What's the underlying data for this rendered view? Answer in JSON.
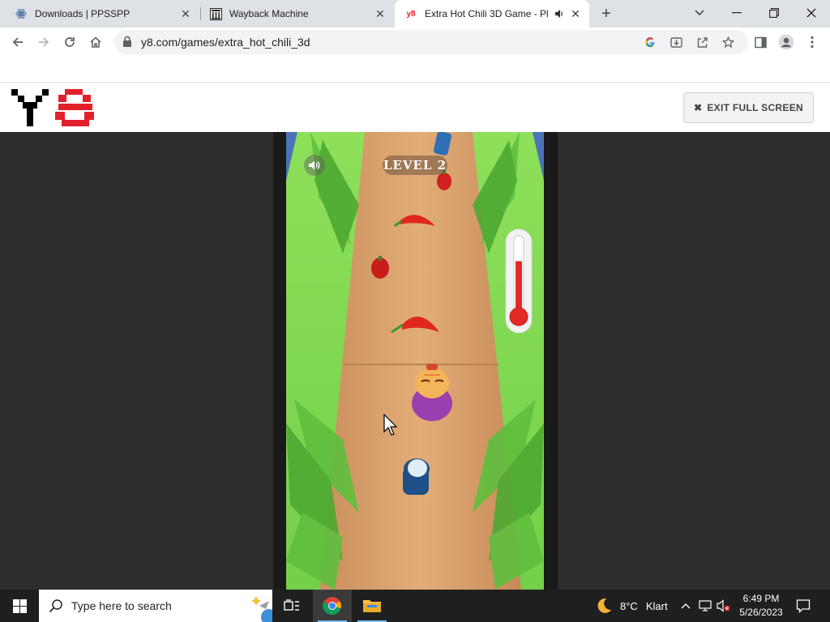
{
  "browser": {
    "tabs": [
      {
        "title": "Downloads | PPSSPP",
        "favicon": "ppsspp-icon",
        "active": false
      },
      {
        "title": "Wayback Machine",
        "favicon": "museum-icon",
        "active": false
      },
      {
        "title": "Extra Hot Chili 3D Game - Pl",
        "favicon": "y8-icon",
        "active": true,
        "audio": true
      }
    ],
    "url": "y8.com/games/extra_hot_chili_3d"
  },
  "site": {
    "logo": "Y8",
    "exit_button": "EXIT FULL SCREEN"
  },
  "game": {
    "level_label": "LEVEL 2",
    "heat_level": 0.7
  },
  "taskbar": {
    "search_placeholder": "Type here to search",
    "weather_temp": "8°C",
    "weather_desc": "Klart",
    "time": "6:49 PM",
    "date": "5/26/2023"
  },
  "colors": {
    "tabstrip": "#dee1e6",
    "grass": "#7bd64f",
    "road": "#d9a16a",
    "logo_red": "#e2202b",
    "thermo_red": "#e52a26"
  }
}
